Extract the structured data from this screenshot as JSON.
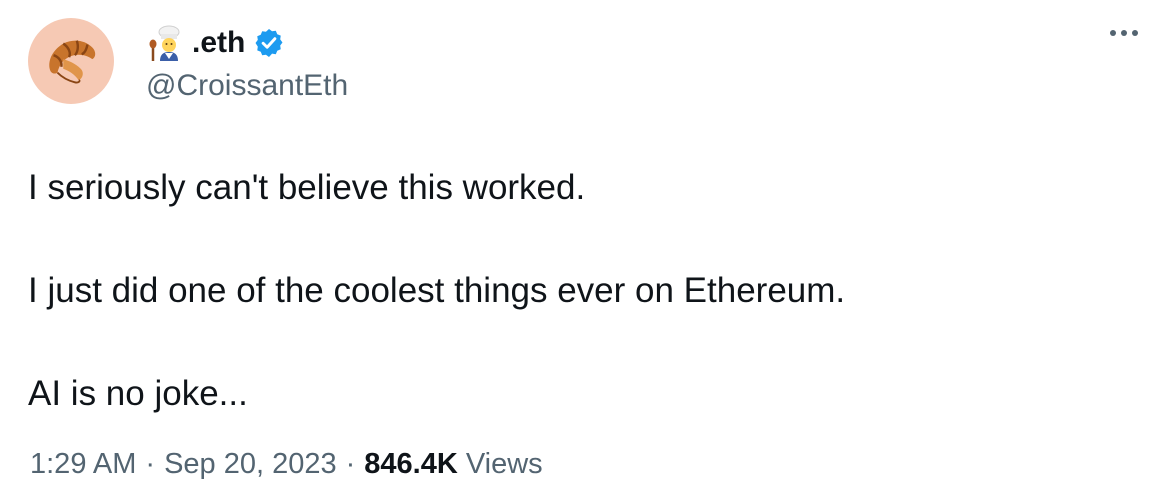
{
  "author": {
    "display_name": ".eth",
    "display_name_emoji": "cook-emoji",
    "handle": "@CroissantEth",
    "avatar_icon": "croissant-icon",
    "verified": true,
    "verified_color": "#1d9bf0"
  },
  "tweet": {
    "paragraphs": [
      "I seriously can't believe this worked.",
      "I just did one of the coolest things ever on Ethereum.",
      "AI is no joke..."
    ]
  },
  "meta": {
    "time": "1:29 AM",
    "separator": "·",
    "date": "Sep 20, 2023",
    "views_count": "846.4K",
    "views_label": "Views"
  },
  "colors": {
    "text": "#0f1419",
    "secondary": "#536471",
    "avatar_bg": "#f6c9b4"
  }
}
